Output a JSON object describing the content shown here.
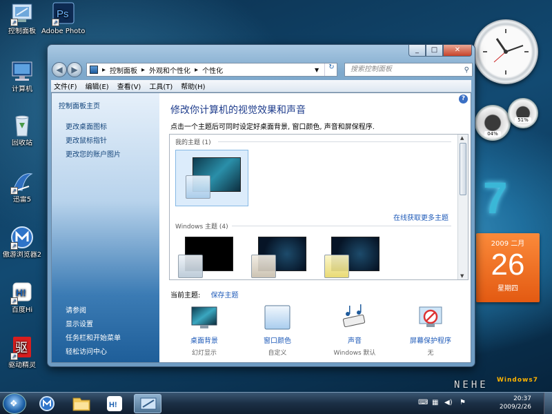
{
  "desktop_icons": [
    {
      "label": "控制面板",
      "icon": "control-panel-icon"
    },
    {
      "label": "Adobe Photosh...",
      "icon": "photoshop-icon"
    },
    {
      "label": "计算机",
      "icon": "computer-icon"
    },
    {
      "label": "回收站",
      "icon": "recycle-bin-icon"
    },
    {
      "label": "迅雷5",
      "icon": "thunder-icon"
    },
    {
      "label": "傲游浏览器2",
      "icon": "maxthon-icon"
    },
    {
      "label": "百度Hi",
      "icon": "baidu-hi-icon"
    },
    {
      "label": "驱动精灵",
      "icon": "driver-genius-icon"
    }
  ],
  "window": {
    "caption_buttons": {
      "minimize": "_",
      "maximize": "□",
      "close": "✕"
    },
    "address": {
      "root": "▸",
      "crumbs": [
        "控制面板",
        "外观和个性化",
        "个性化"
      ],
      "sep": "▸"
    },
    "search_placeholder": "搜索控制面板",
    "menu": [
      "文件(F)",
      "编辑(E)",
      "查看(V)",
      "工具(T)",
      "帮助(H)"
    ],
    "sidebar": {
      "home": "控制面板主页",
      "links": [
        "更改桌面图标",
        "更改鼠标指针",
        "更改您的账户图片"
      ],
      "see_also": "请参阅",
      "lower_links": [
        "显示设置",
        "任务栏和开始菜单",
        "轻松访问中心"
      ]
    },
    "main": {
      "title": "修改你计算机的视觉效果和声音",
      "description": "点击一个主题后可同时设定好桌面背景, 窗口颜色, 声音和屏保程序.",
      "my_themes": "我的主题 (1)",
      "online_link": "在线获取更多主题",
      "windows_themes": "Windows 主题 (4)",
      "current_theme_label": "当前主题:",
      "save_theme": "保存主题",
      "options": [
        {
          "label": "桌面背景",
          "value": "幻灯显示",
          "icon": "desktop-background-icon"
        },
        {
          "label": "窗口颜色",
          "value": "自定义",
          "icon": "window-color-icon"
        },
        {
          "label": "声音",
          "value": "Windows 默认",
          "icon": "sound-icon"
        },
        {
          "label": "屏幕保护程序",
          "value": "无",
          "icon": "screensaver-icon"
        }
      ],
      "help": "?"
    }
  },
  "gadgets": {
    "meter_left": "04%",
    "meter_right": "51%",
    "calendar": {
      "year_month": "2009 二月",
      "day": "26",
      "weekday": "星期四"
    },
    "logo_digit": "7"
  },
  "taskbar": {
    "time": "20:37",
    "date": "2009/2/26",
    "watermark": "NEHE",
    "watermark2": "Windows7"
  },
  "colors": {
    "accent_link": "#1e5ab8",
    "title_blue": "#1e3c8c",
    "calendar_orange": "#e35a12"
  }
}
